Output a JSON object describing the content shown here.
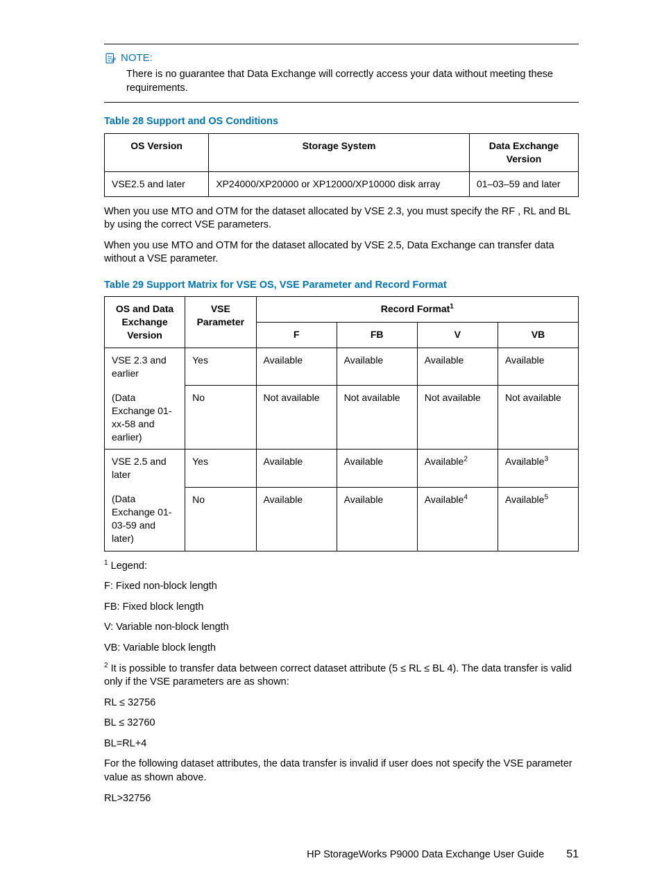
{
  "note": {
    "label": "NOTE:",
    "body": "There is no guarantee that Data Exchange will correctly access your data without meeting these requirements."
  },
  "table28": {
    "title": "Table 28 Support and OS Conditions",
    "h1": "OS Version",
    "h2": "Storage System",
    "h3": "Data Exchange Version",
    "r1c1": "VSE2.5 and later",
    "r1c2": "XP24000/XP20000 or XP12000/XP10000 disk array",
    "r1c3": "01–03–59 and later"
  },
  "para1": "When you use MTO and OTM for the dataset allocated by VSE 2.3, you must specify the RF , RL and BL by using the correct VSE parameters.",
  "para2": "When you use MTO and OTM for the dataset allocated by VSE 2.5, Data Exchange can transfer data without a VSE parameter.",
  "table29": {
    "title": "Table 29 Support Matrix for VSE OS, VSE Parameter and Record Format",
    "h_os": "OS and Data Exchange Version",
    "h_vse": "VSE Parameter",
    "h_rf": "Record Format",
    "h_rf_sup": "1",
    "h_f": "F",
    "h_fb": "FB",
    "h_v": "V",
    "h_vb": "VB",
    "g1_os_a": "VSE 2.3 and earlier",
    "g1_os_b": "(Data Exchange 01-xx-58 and earlier)",
    "g1r1_vse": "Yes",
    "g1r1_f": "Available",
    "g1r1_fb": "Available",
    "g1r1_v": "Available",
    "g1r1_vb": "Available",
    "g1r2_vse": "No",
    "g1r2_f": "Not available",
    "g1r2_fb": "Not available",
    "g1r2_v": "Not available",
    "g1r2_vb": "Not available",
    "g2_os_a": "VSE 2.5 and later",
    "g2_os_b": "(Data Exchange 01-03-59 and later)",
    "g2r1_vse": "Yes",
    "g2r1_f": "Available",
    "g2r1_fb": "Available",
    "g2r1_v": "Available",
    "g2r1_v_sup": "2",
    "g2r1_vb": "Available",
    "g2r1_vb_sup": "3",
    "g2r2_vse": "No",
    "g2r2_f": "Available",
    "g2r2_fb": "Available",
    "g2r2_v": "Available",
    "g2r2_v_sup": "4",
    "g2r2_vb": "Available",
    "g2r2_vb_sup": "5"
  },
  "fn1": {
    "num": "1",
    "lead": " Legend:",
    "l1": "F: Fixed non-block length",
    "l2": "FB: Fixed block length",
    "l3": "V: Variable non-block length",
    "l4": "VB: Variable block length"
  },
  "fn2": {
    "num": "2",
    "body": " It is possible to transfer data between correct dataset attribute (5 ≤ RL ≤ BL 4). The data transfer is valid only if the VSE parameters are as shown:",
    "l1": "RL ≤ 32756",
    "l2": "BL ≤ 32760",
    "l3": "BL=RL+4"
  },
  "para3": "For the following dataset attributes, the data transfer is invalid if user does not specify the VSE parameter value as shown above.",
  "para3_l1": "RL>32756",
  "footer": {
    "title": "HP StorageWorks P9000 Data Exchange User Guide",
    "page": "51"
  }
}
